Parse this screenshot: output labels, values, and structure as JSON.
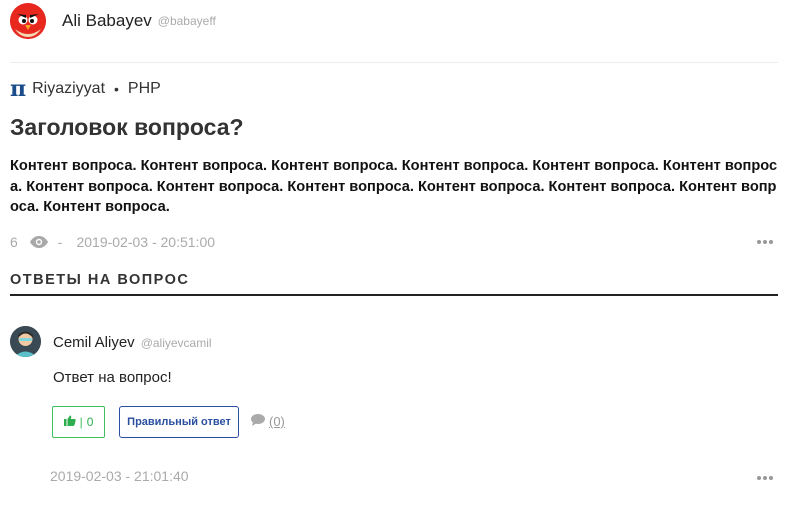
{
  "question": {
    "author": {
      "name": "Ali Babayev",
      "handle": "@babayeff"
    },
    "category": {
      "name": "Riyaziyyat",
      "separator": "•",
      "tag": "PHP"
    },
    "title": "Заголовок вопроса?",
    "content": "Контент вопроса. Контент вопроса. Контент вопроса. Контент вопроса. Контент вопроса. Контент вопроса. Контент вопроса. Контент вопроса. Контент вопроса. Контент вопроса. Контент вопроса. Контент вопроса. Контент вопроса.",
    "views": "6",
    "meta_separator": "-",
    "date": "2019-02-03 - 20:51:00"
  },
  "answers_section": {
    "heading": "ОТВЕТЫ НА ВОПРОС"
  },
  "answer": {
    "author": {
      "name": "Cemil Aliyev",
      "handle": "@aliyevcamil"
    },
    "text": "Ответ на вопрос!",
    "likes": "0",
    "correct_label": "Правильный ответ",
    "comments": "(0)",
    "date": "2019-02-03 - 21:01:40"
  },
  "colors": {
    "like_green": "#3fbf5f",
    "correct_blue": "#2a4fa0",
    "category_icon": "#1a4c8a",
    "avatar_red": "#e8271f"
  },
  "icons": {
    "category": "pi-icon",
    "views": "eye-icon",
    "like": "thumbs-up-icon",
    "comments": "comment-icon",
    "more": "more-horizontal-icon"
  }
}
